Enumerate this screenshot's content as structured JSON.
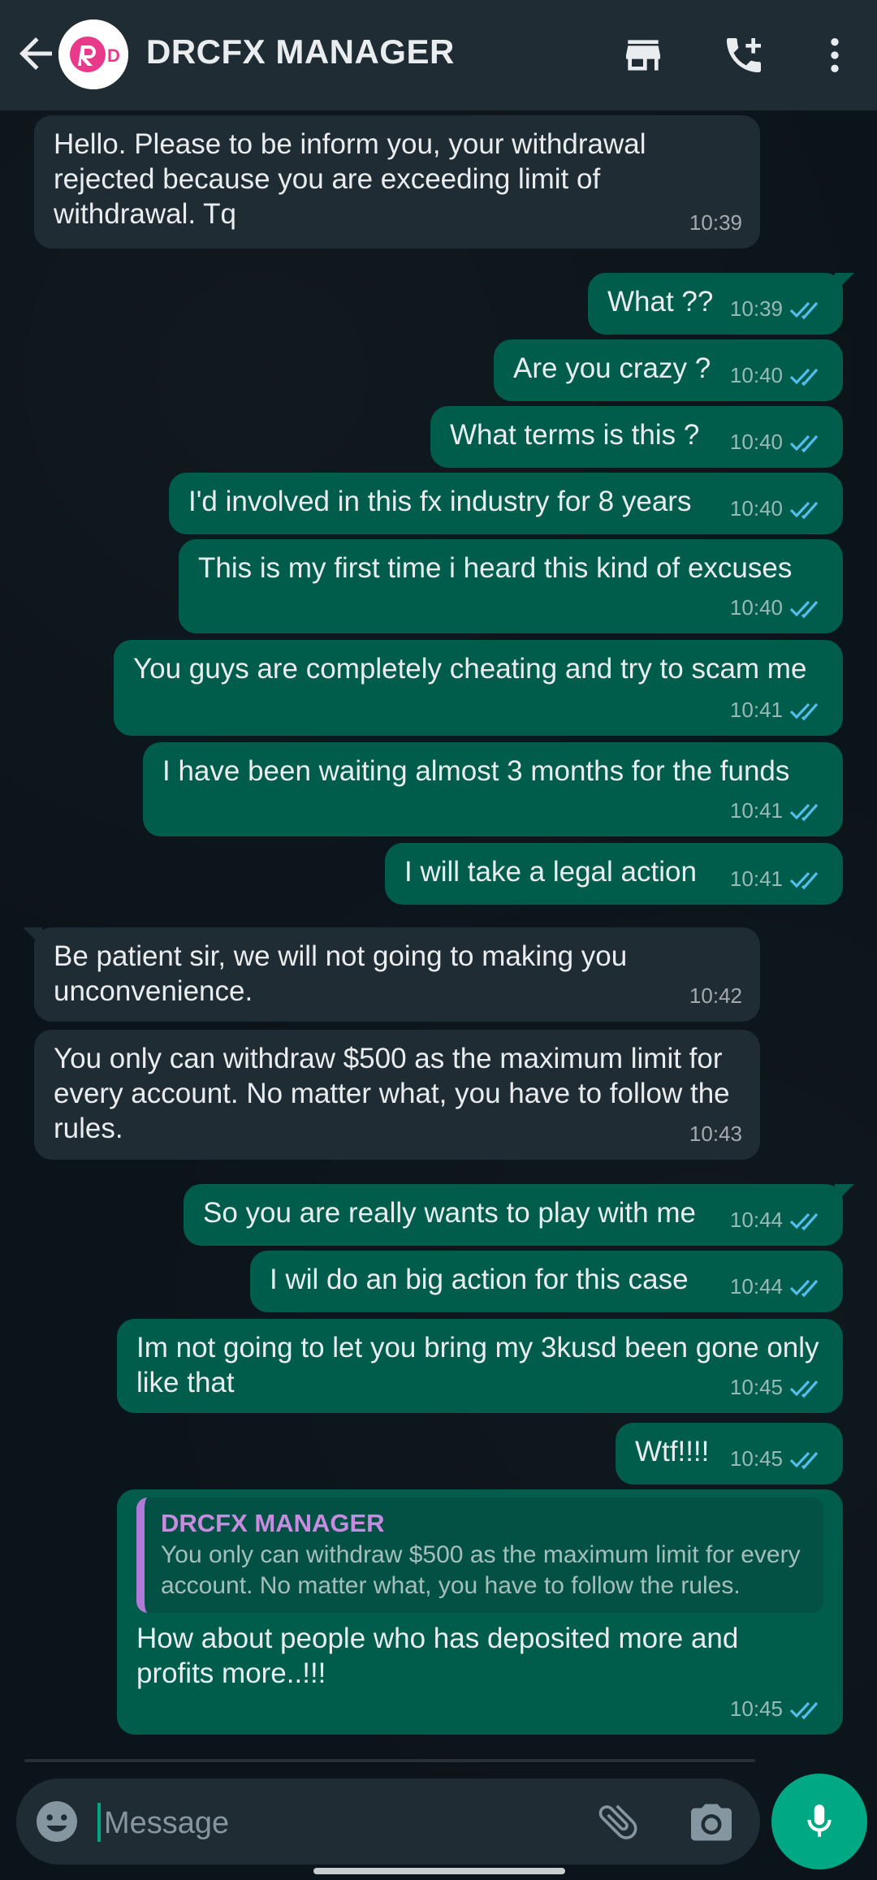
{
  "header": {
    "contact_name": "DRCFX MANAGER"
  },
  "messages": [
    {
      "dir": "in",
      "text": "Hello. Please to be inform you, your withdrawal rejected because you are exceeding limit of withdrawal. Tq",
      "time": "10:39"
    },
    {
      "dir": "out",
      "text": "What ??",
      "time": "10:39"
    },
    {
      "dir": "out",
      "text": "Are you crazy ?",
      "time": "10:40"
    },
    {
      "dir": "out",
      "text": "What terms is this ?",
      "time": "10:40"
    },
    {
      "dir": "out",
      "text": "I'd involved in this fx industry for 8 years",
      "time": "10:40"
    },
    {
      "dir": "out",
      "text": "This is my first time i heard this kind of excuses",
      "time": "10:40"
    },
    {
      "dir": "out",
      "text": "You guys are completely cheating and try to scam me",
      "time": "10:41"
    },
    {
      "dir": "out",
      "text": "I have been waiting almost 3 months for the funds",
      "time": "10:41"
    },
    {
      "dir": "out",
      "text": "I will take a legal action",
      "time": "10:41"
    },
    {
      "dir": "in",
      "text": "Be patient sir, we will not going to making you unconvenience.",
      "time": "10:42"
    },
    {
      "dir": "in",
      "text": "You only can withdraw $500 as the maximum limit for every account. No matter what, you have to follow the rules.",
      "time": "10:43"
    },
    {
      "dir": "out",
      "text": "So you are really wants to play with me",
      "time": "10:44"
    },
    {
      "dir": "out",
      "text": "I wil do an big action for this case",
      "time": "10:44"
    },
    {
      "dir": "out",
      "text": "Im not going to let you bring my 3kusd been gone only like that",
      "time": "10:45"
    },
    {
      "dir": "out",
      "text": "Wtf!!!!",
      "time": "10:45"
    },
    {
      "dir": "out",
      "text": "How about people who has deposited more and profits more..!!!",
      "time": "10:45",
      "quote": {
        "author": "DRCFX MANAGER",
        "text": "You only can withdraw $500 as the maximum limit for every account. No matter what, you have to follow the rules."
      }
    }
  ],
  "composer": {
    "placeholder": "Message"
  },
  "colors": {
    "header_bg": "#202c33",
    "incoming_bg": "#202c33",
    "outgoing_bg": "#005c4b",
    "accent": "#00a884",
    "read_ticks": "#53bdeb",
    "quote_author": "#c78ce0"
  },
  "icons": [
    "back-arrow-icon",
    "brand-logo-icon",
    "shop-icon",
    "add-call-icon",
    "more-vert-icon",
    "double-check-icon",
    "emoji-icon",
    "attach-icon",
    "camera-icon",
    "mic-icon"
  ]
}
